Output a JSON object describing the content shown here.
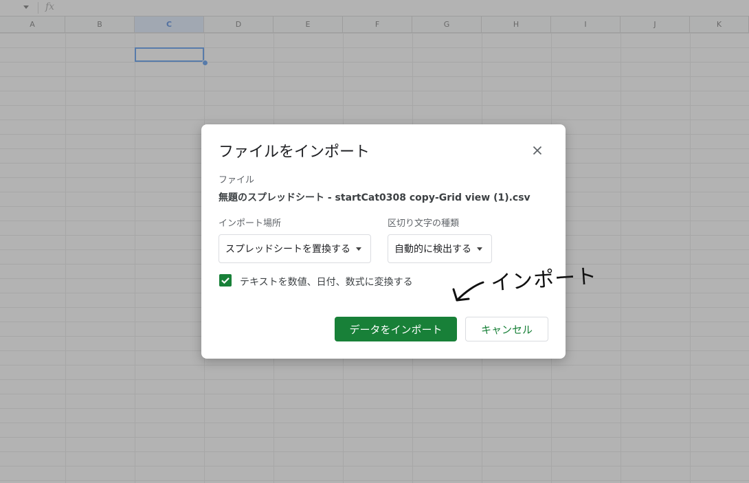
{
  "spreadsheet": {
    "columns": [
      "A",
      "B",
      "C",
      "D",
      "E",
      "F",
      "G",
      "H",
      "I",
      "J",
      "K"
    ],
    "selected_column": "C",
    "formula_icon": "fx"
  },
  "dialog": {
    "title": "ファイルをインポート",
    "file_label": "ファイル",
    "file_name": "無題のスプレッドシート - startCat0308 copy-Grid view (1).csv",
    "import_location_label": "インポート場所",
    "import_location_value": "スプレッドシートを置換する",
    "separator_label": "区切り文字の種類",
    "separator_value": "自動的に検出する",
    "convert_checkbox_label": "テキストを数値、日付、数式に変換する",
    "convert_checked": true,
    "import_button": "データをインポート",
    "cancel_button": "キャンセル"
  },
  "annotation": {
    "handwritten_text": "インポート"
  },
  "colors": {
    "primary_green": "#188038",
    "selection_blue": "#1a73e8",
    "overlay": "rgba(128,128,128,0.6)"
  }
}
